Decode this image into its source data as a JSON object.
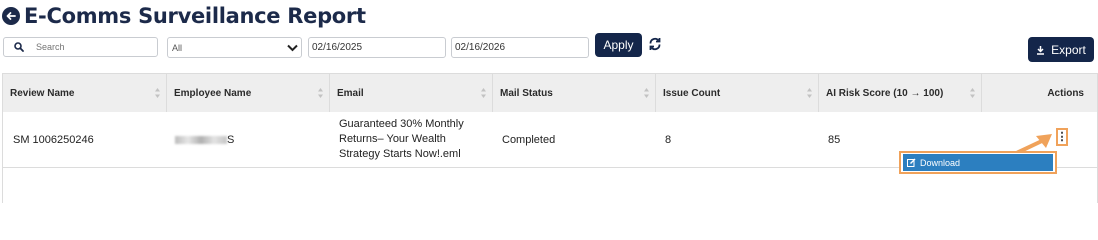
{
  "header": {
    "title": "E-Comms Surveillance Report",
    "back_icon": "arrow-left-icon"
  },
  "filters": {
    "search_placeholder": "Search",
    "select_value": "All",
    "start_date": "02/16/2025",
    "end_date": "02/16/2026",
    "apply_label": "Apply",
    "refresh_icon": "refresh-icon"
  },
  "export_label": "Export",
  "table": {
    "columns": [
      "Review Name",
      "Employee Name",
      "Email",
      "Mail Status",
      "Issue Count",
      "AI Risk Score (10 → 100)",
      "Actions"
    ],
    "rows": [
      {
        "review_name": "SM 1006250246",
        "employee_name_end": "S",
        "email_line1": "Guaranteed 30% Monthly",
        "email_line2": "Returns– Your Wealth",
        "email_line3": "Strategy Starts Now!.eml",
        "mail_status": "Completed",
        "issue_count": "8",
        "ai_risk_score": "85",
        "actions_icon": "kebab-menu-icon"
      }
    ]
  },
  "menu": {
    "download_label": "Download",
    "icon": "edit-icon"
  },
  "colors": {
    "primary": "#14264a",
    "highlight": "#f0a25a",
    "menu_blue": "#2c7fc0",
    "header_bg": "#eeeeee"
  }
}
